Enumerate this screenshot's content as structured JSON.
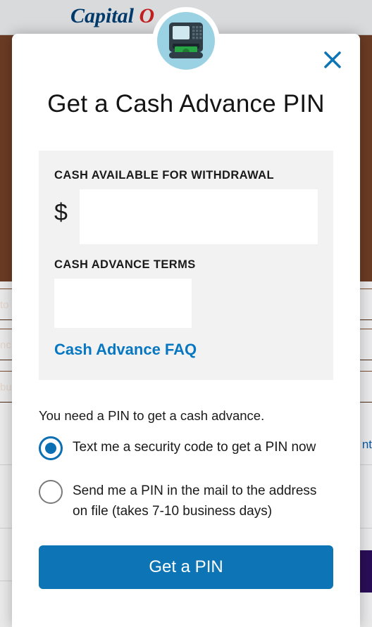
{
  "background": {
    "brand": "CapitalOne",
    "nav_fragment_1": "to",
    "nav_fragment_2": "nc",
    "nav_fragment_3": "bu",
    "right_fragment": "nt"
  },
  "modal": {
    "title": "Get a Cash Advance PIN",
    "box": {
      "avail_label": "CASH AVAILABLE FOR WITHDRAWAL",
      "currency_symbol": "$",
      "avail_value": "",
      "terms_label": "CASH ADVANCE TERMS",
      "terms_value": "",
      "faq_link": "Cash Advance FAQ"
    },
    "need_pin_text": "You need a PIN to get a cash advance.",
    "options": [
      {
        "label": "Text me a security code to get a PIN now",
        "selected": true
      },
      {
        "label": "Send me a PIN in the mail to the address on file (takes 7-10 business days)",
        "selected": false
      }
    ],
    "cta_label": "Get a PIN"
  }
}
